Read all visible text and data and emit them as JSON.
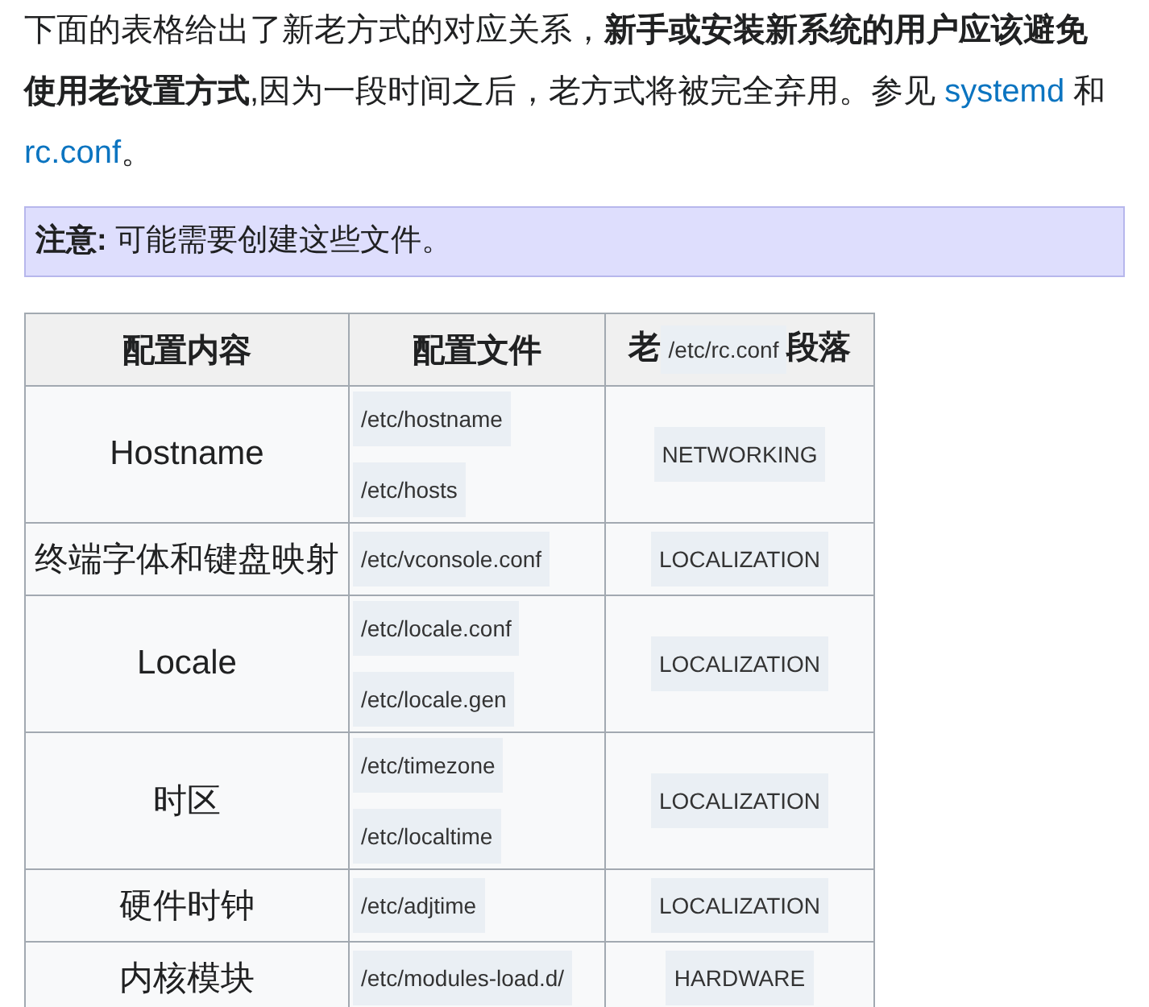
{
  "intro": [
    {
      "kind": "text",
      "text": "下面的表格给出了新老方式的对应关系，**新手或安装新系统的用户应该避免使用老设置方式**,因为一段时间之后，老方式将被完全弃用。参见 "
    },
    {
      "kind": "link",
      "text": "systemd"
    },
    {
      "kind": "text",
      "text": " 和 "
    },
    {
      "kind": "link",
      "text": "rc.conf"
    },
    {
      "kind": "text",
      "text": "。"
    }
  ],
  "note": "**注意:** 可能需要创建这些文件。",
  "table": {
    "columns": [
      {
        "kind": "plain",
        "label": "配置内容"
      },
      {
        "kind": "plain",
        "label": "配置文件"
      },
      {
        "kind": "mixed",
        "before": "老",
        "code": "/etc/rc.conf",
        "after": "段落"
      }
    ],
    "rows": [
      {
        "setting": "Hostname",
        "files": [
          "/etc/hostname",
          "/etc/hosts"
        ],
        "section": "NETWORKING"
      },
      {
        "setting": "终端字体和键盘映射",
        "files": [
          "/etc/vconsole.conf"
        ],
        "section": "LOCALIZATION"
      },
      {
        "setting": "Locale",
        "files": [
          "/etc/locale.conf",
          "/etc/locale.gen"
        ],
        "section": "LOCALIZATION"
      },
      {
        "setting": "时区",
        "files": [
          "/etc/timezone",
          "/etc/localtime"
        ],
        "section": "LOCALIZATION"
      },
      {
        "setting": "硬件时钟",
        "files": [
          "/etc/adjtime"
        ],
        "section": "LOCALIZATION"
      },
      {
        "setting": "内核模块",
        "files": [
          "/etc/modules-load.d/"
        ],
        "section": "HARDWARE"
      }
    ]
  }
}
